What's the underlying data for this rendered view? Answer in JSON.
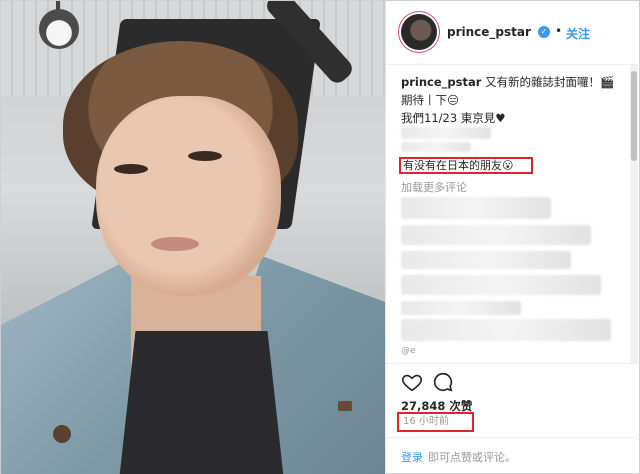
{
  "header": {
    "username": "prince_pstar",
    "verified_icon": "verified-badge-icon",
    "separator": "•",
    "follow_label": "关注"
  },
  "caption": {
    "username": "prince_pstar",
    "line1": "又有新的雜誌封面囉！🎬",
    "line2": "期待丨下😑",
    "line3": "我們11/23 東京見♥"
  },
  "comments": {
    "highlighted": "有没有在日本的朋友😮",
    "load_more": "加载更多评论",
    "partial_tag": "@e"
  },
  "actions": {
    "like_icon": "heart-icon",
    "comment_icon": "comment-bubble-icon",
    "likes": "27,848 次赞",
    "time": "16 小时前"
  },
  "footer": {
    "login": "登录",
    "rest": "即可点赞或评论。"
  },
  "colors": {
    "link_blue": "#3897f0",
    "highlight_red": "#e0242c",
    "muted_gray": "#999999"
  }
}
